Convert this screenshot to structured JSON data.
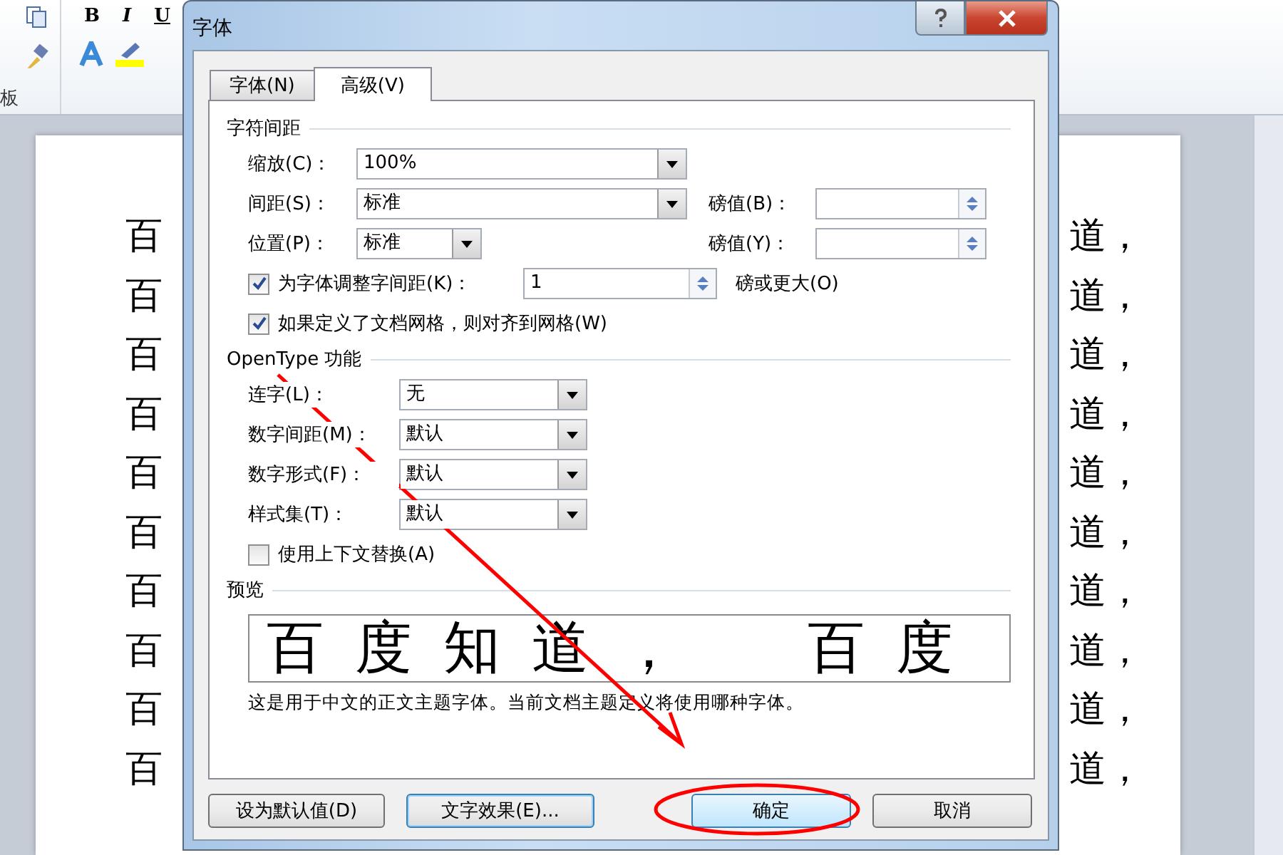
{
  "ribbon": {
    "buttons": [
      "B",
      "I",
      "U"
    ],
    "group_label": "板"
  },
  "document": {
    "lines": [
      {
        "start": "百",
        "end": "道，"
      },
      {
        "start": "百",
        "end": "道，"
      },
      {
        "start": "百",
        "end": "道，"
      },
      {
        "start": "百",
        "end": "道，"
      },
      {
        "start": "百",
        "end": "道，"
      },
      {
        "start": "百",
        "end": "道，"
      },
      {
        "start": "百",
        "end": "道，"
      },
      {
        "start": "百",
        "end": "道，"
      },
      {
        "start": "百",
        "end": "道，"
      },
      {
        "start": "百",
        "end": "道，"
      }
    ]
  },
  "dialog": {
    "title": "字体",
    "tabs": [
      {
        "label": "字体(N)",
        "selected": false
      },
      {
        "label": "高级(V)",
        "selected": true
      }
    ],
    "spacing": {
      "heading": "字符间距",
      "scale": {
        "label": "缩放(C)：",
        "value": "100%"
      },
      "spacing": {
        "label": "间距(S)：",
        "value": "标准",
        "points_label": "磅值(B)："
      },
      "position": {
        "label": "位置(P)：",
        "value": "标准",
        "points_label": "磅值(Y)："
      },
      "kerning": {
        "label": "为字体调整字间距(K)：",
        "checked": true,
        "value": "1",
        "suffix": "磅或更大(O)"
      },
      "grid": {
        "label": "如果定义了文档网格，则对齐到网格(W)",
        "checked": true
      }
    },
    "opentype": {
      "heading": "OpenType 功能",
      "rows": [
        {
          "label": "连字(L)：",
          "value": "无"
        },
        {
          "label": "数字间距(M)：",
          "value": "默认"
        },
        {
          "label": "数字形式(F)：",
          "value": "默认"
        },
        {
          "label": "样式集(T)：",
          "value": "默认"
        }
      ],
      "contextual": {
        "label": "使用上下文替换(A)",
        "checked": false
      }
    },
    "preview": {
      "heading": "预览",
      "sample": "百度知道，  百度",
      "note": "这是用于中文的正文主题字体。当前文档主题定义将使用哪种字体。"
    },
    "buttons": [
      {
        "label": "设为默认值(D)",
        "kind": "plain"
      },
      {
        "label": "文字效果(E)...",
        "kind": "focused"
      },
      {
        "label": "确定",
        "kind": "default"
      },
      {
        "label": "取消",
        "kind": "plain"
      }
    ]
  }
}
